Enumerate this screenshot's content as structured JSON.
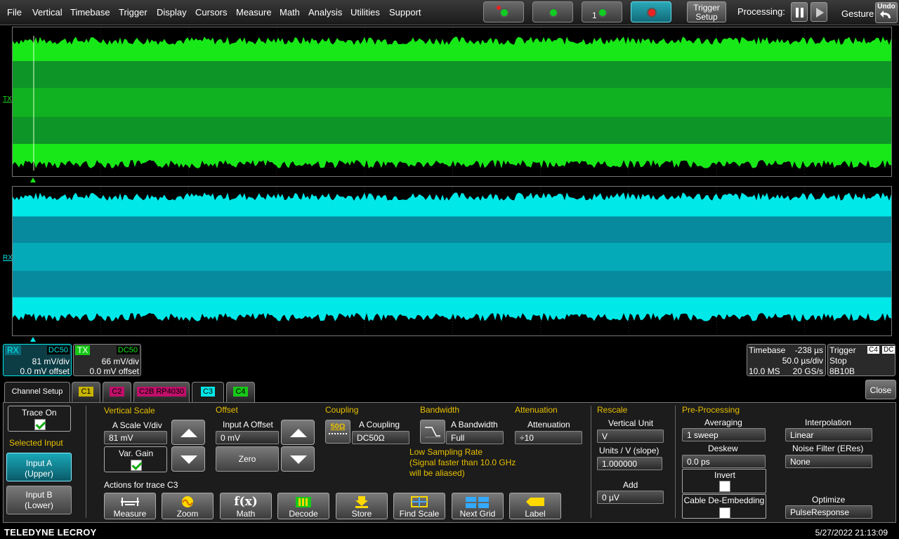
{
  "menu": [
    "File",
    "Vertical",
    "Timebase",
    "Trigger",
    "Display",
    "Cursors",
    "Measure",
    "Math",
    "Analysis",
    "Utilities",
    "Support"
  ],
  "toolbar": {
    "trigger_setup_line1": "Trigger",
    "trigger_setup_line2": "Setup",
    "processing": "Processing:",
    "gesture": "Gesture",
    "undo": "Undo",
    "mode_single_label": "1"
  },
  "traces": {
    "tx_label": "TX",
    "rx_label": "RX",
    "colors": {
      "tx": "#18e818",
      "rx": "#00e8e8"
    }
  },
  "descriptors": {
    "rx": {
      "name": "RX",
      "coupling": "DC50",
      "scale": "81 mV/div",
      "offset": "0.0 mV offset"
    },
    "tx": {
      "name": "TX",
      "coupling": "DC50",
      "scale": "66 mV/div",
      "offset": "0.0 mV offset"
    },
    "timebase": {
      "title": "Timebase",
      "delay": "-238 µs",
      "per_div": "50.0 µs/div",
      "samples": "10.0 MS",
      "rate": "20 GS/s"
    },
    "trigger": {
      "title": "Trigger",
      "channel": "C4",
      "coupling": "DC",
      "mode": "Stop",
      "type": "8B10B"
    }
  },
  "close_label": "Close",
  "tabs": [
    "Channel Setup",
    "C1",
    "C2",
    "C2B RP4030",
    "C3",
    "C4"
  ],
  "panel": {
    "trace_on": "Trace On",
    "selected_input": "Selected Input",
    "input_a": [
      "Input A",
      "(Upper)"
    ],
    "input_b": [
      "Input B",
      "(Lower)"
    ],
    "vertical_scale": "Vertical Scale",
    "scale_label": "A Scale V/div",
    "scale_value": "81 mV",
    "var_gain": "Var. Gain",
    "offset_title": "Offset",
    "offset_label": "Input A Offset",
    "offset_value": "0 mV",
    "zero": "Zero",
    "coupling_title": "Coupling",
    "coupling_icon": "50Ω",
    "coupling_label": "A Coupling",
    "coupling_value": "DC50Ω",
    "bandwidth_title": "Bandwidth",
    "bandwidth_label": "A Bandwidth",
    "bandwidth_value": "Full",
    "attenuation_title": "Attenuation",
    "attenuation_label": "Attenuation",
    "attenuation_value": "÷10",
    "warning": [
      "Low Sampling Rate",
      "(Signal faster than 10.0 GHz",
      "will be aliased)"
    ],
    "rescale_title": "Rescale",
    "vertical_unit_label": "Vertical Unit",
    "vertical_unit_value": "V",
    "units_slope_label": "Units / V (slope)",
    "units_slope_value": "1.000000",
    "add_label": "Add",
    "add_value": "0 µV",
    "preproc_title": "Pre-Processing",
    "averaging_label": "Averaging",
    "averaging_value": "1 sweep",
    "deskew_label": "Deskew",
    "deskew_value": "0.0 ps",
    "invert_label": "Invert",
    "cable_label": "Cable De-Embedding",
    "interp_label": "Interpolation",
    "interp_value": "Linear",
    "noise_label": "Noise Filter (ERes)",
    "noise_value": "None",
    "optimize_label": "Optimize",
    "optimize_value": "PulseResponse",
    "actions_title": "Actions for trace C3",
    "actions": [
      "Measure",
      "Zoom",
      "Math",
      "Decode",
      "Store",
      "Find Scale",
      "Next Grid",
      "Label"
    ]
  },
  "footer": {
    "brand": "TELEDYNE LECROY",
    "datetime": "5/27/2022 21:13:09"
  }
}
